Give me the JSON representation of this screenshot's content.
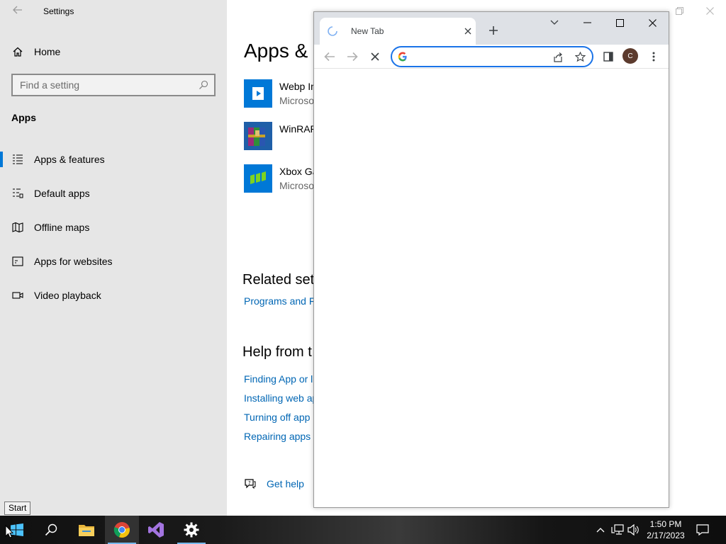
{
  "settings": {
    "window_title": "Settings",
    "home_label": "Home",
    "search_placeholder": "Find a setting",
    "section_title": "Apps",
    "nav": [
      {
        "label": "Apps & features",
        "icon": "apps-features-icon",
        "active": true
      },
      {
        "label": "Default apps",
        "icon": "default-apps-icon",
        "active": false
      },
      {
        "label": "Offline maps",
        "icon": "offline-maps-icon",
        "active": false
      },
      {
        "label": "Apps for websites",
        "icon": "apps-websites-icon",
        "active": false
      },
      {
        "label": "Video playback",
        "icon": "video-playback-icon",
        "active": false
      }
    ],
    "page_title": "Apps & f",
    "apps": [
      {
        "name": "Webp In",
        "publisher": "Microso",
        "icon": "webp-app-icon"
      },
      {
        "name": "WinRAR",
        "publisher": "",
        "icon": "winrar-icon"
      },
      {
        "name": "Xbox Ga",
        "publisher": "Microso",
        "icon": "xbox-icon"
      }
    ],
    "related_heading": "Related sett",
    "related_links": [
      "Programs and F"
    ],
    "help_heading": "Help from t",
    "help_links": [
      "Finding App or l",
      "Installing web ap",
      "Turning off app",
      "Repairing apps a"
    ],
    "get_help": "Get help"
  },
  "chrome": {
    "tab_title": "New Tab",
    "omnibox_value": "",
    "profile_initial": "C"
  },
  "tooltip": "Start",
  "taskbar": {
    "time": "1:50 PM",
    "date": "2/17/2023"
  },
  "colors": {
    "accent": "#0078d7",
    "link": "#0066b4",
    "chrome_focus": "#1a73e8"
  }
}
